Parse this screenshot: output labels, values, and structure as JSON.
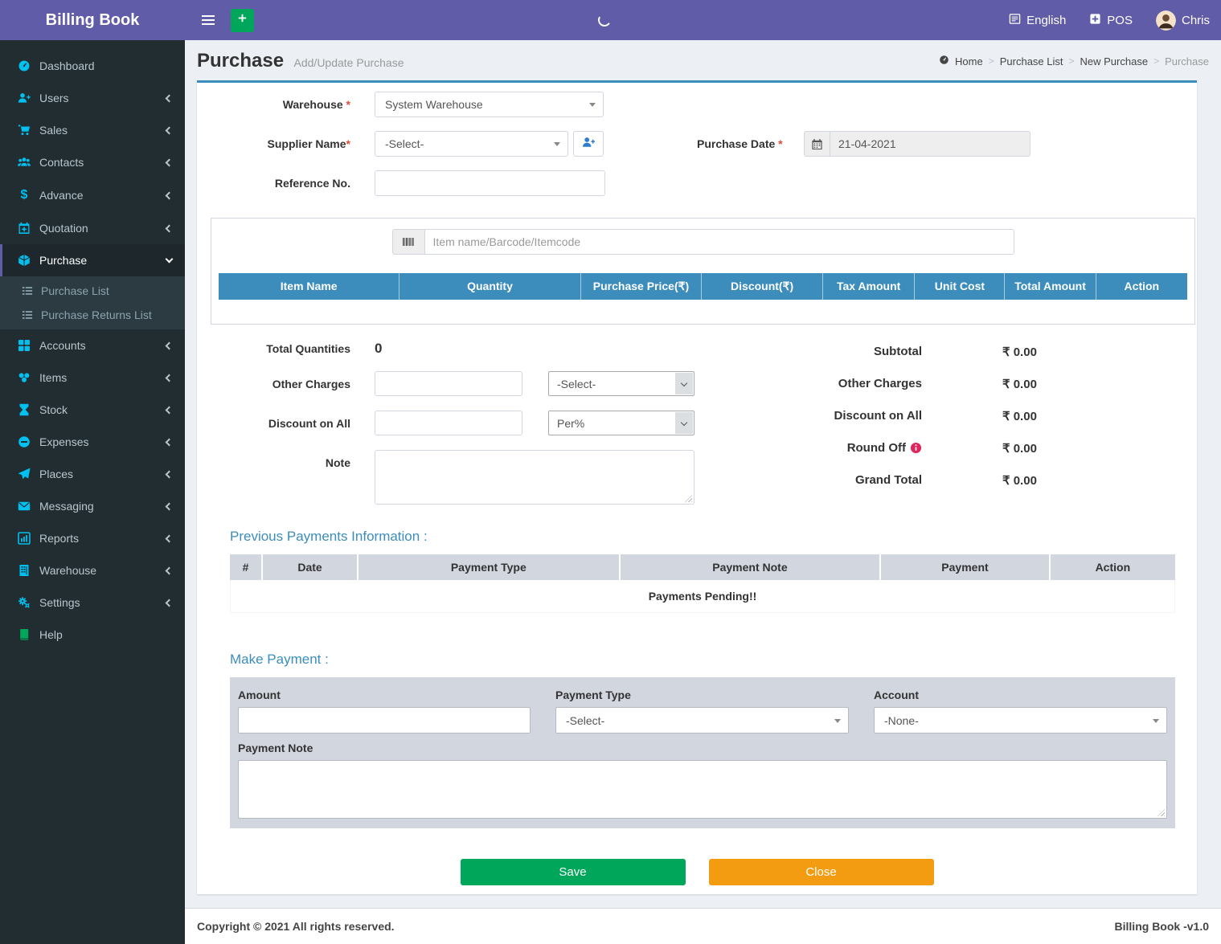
{
  "app": {
    "title": "Billing Book"
  },
  "topbar": {
    "language": "English",
    "pos": "POS",
    "user": "Chris"
  },
  "sidebar": {
    "items": [
      {
        "label": "Dashboard",
        "icon": "dashboard"
      },
      {
        "label": "Users",
        "icon": "user-plus"
      },
      {
        "label": "Sales",
        "icon": "cart"
      },
      {
        "label": "Contacts",
        "icon": "users"
      },
      {
        "label": "Advance",
        "icon": "dollar",
        "glyph": "$"
      },
      {
        "label": "Quotation",
        "icon": "calendar-plus"
      },
      {
        "label": "Purchase",
        "icon": "cube",
        "active": true,
        "submenu": [
          "Purchase List",
          "Purchase Returns List"
        ]
      },
      {
        "label": "Accounts",
        "icon": "grid"
      },
      {
        "label": "Items",
        "icon": "spheres"
      },
      {
        "label": "Stock",
        "icon": "hourglass"
      },
      {
        "label": "Expenses",
        "icon": "minus-circle"
      },
      {
        "label": "Places",
        "icon": "paper-plane"
      },
      {
        "label": "Messaging",
        "icon": "envelope"
      },
      {
        "label": "Reports",
        "icon": "bar-chart"
      },
      {
        "label": "Warehouse",
        "icon": "building"
      },
      {
        "label": "Settings",
        "icon": "gears"
      },
      {
        "label": "Help",
        "icon": "book"
      }
    ]
  },
  "page": {
    "title": "Purchase",
    "subtitle": "Add/Update Purchase",
    "breadcrumb": [
      "Home",
      "Purchase List",
      "New Purchase",
      "Purchase"
    ]
  },
  "form": {
    "required_mark": "*",
    "warehouse_label": "Warehouse",
    "warehouse_value": "System Warehouse",
    "supplier_label": "Supplier Name",
    "supplier_value": "-Select-",
    "reference_label": "Reference No.",
    "date_label": "Purchase Date",
    "date_value": "21-04-2021"
  },
  "items": {
    "search_placeholder": "Item name/Barcode/Itemcode",
    "columns": [
      "Item Name",
      "Quantity",
      "Purchase Price(₹)",
      "Discount(₹)",
      "Tax Amount",
      "Unit Cost",
      "Total Amount",
      "Action"
    ]
  },
  "totals": {
    "total_quantities_label": "Total Quantities",
    "total_quantities_value": "0",
    "other_charges_label": "Other Charges",
    "other_charges_select": "-Select-",
    "discount_label": "Discount on All",
    "discount_select": "Per%",
    "note_label": "Note",
    "right": [
      {
        "label": "Subtotal",
        "value": "₹ 0.00"
      },
      {
        "label": "Other Charges",
        "value": "₹ 0.00"
      },
      {
        "label": "Discount on All",
        "value": "₹ 0.00"
      },
      {
        "label": "Round Off",
        "value": "₹ 0.00"
      },
      {
        "label": "Grand Total",
        "value": "₹ 0.00"
      }
    ]
  },
  "payments": {
    "heading": "Previous Payments Information :",
    "columns": [
      "#",
      "Date",
      "Payment Type",
      "Payment Note",
      "Payment",
      "Action"
    ],
    "empty_message": "Payments Pending!!"
  },
  "make_payment": {
    "heading": "Make Payment :",
    "amount_label": "Amount",
    "payment_type_label": "Payment Type",
    "payment_type_value": "-Select-",
    "account_label": "Account",
    "account_value": "-None-",
    "note_label": "Payment Note"
  },
  "actions": {
    "save": "Save",
    "close": "Close"
  },
  "footer": {
    "copyright": "Copyright © 2021 All rights reserved.",
    "version": "Billing Book -v1.0"
  },
  "colors": {
    "header": "#605ca8",
    "sidebar": "#222d32",
    "primary": "#3c8dbc",
    "success": "#00a65a",
    "warning": "#f39c12",
    "sidebar_icon": "#00c0ef",
    "required": "#dd4b39",
    "round_off_info": "#e0245e"
  }
}
